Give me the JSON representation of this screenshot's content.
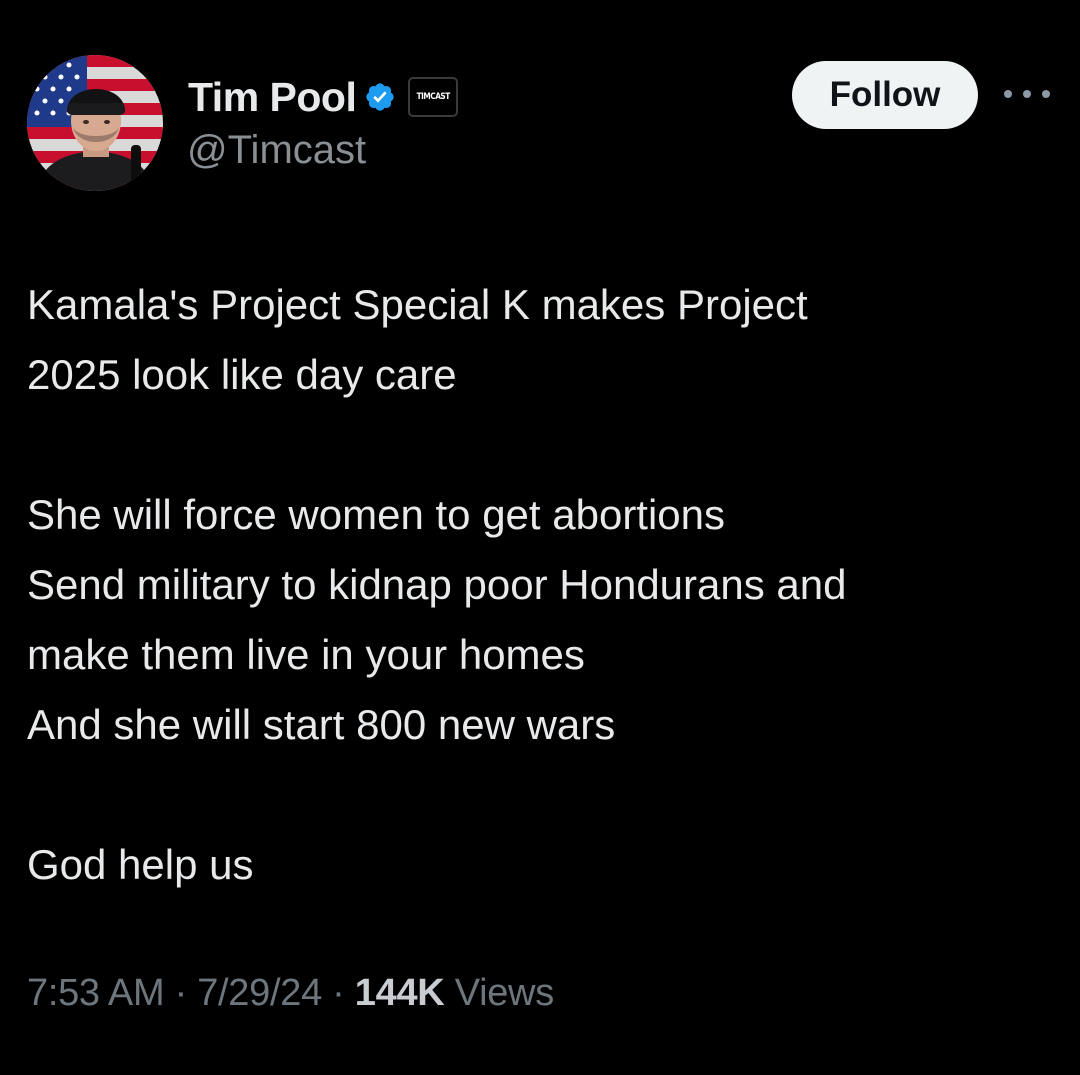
{
  "author": {
    "display_name": "Tim Pool",
    "handle": "@Timcast",
    "affiliate_badge_text": "TIMCAST",
    "verified_color": "#1d9bf0"
  },
  "actions": {
    "follow_label": "Follow",
    "more_icon": "more-horizontal-icon"
  },
  "tweet": {
    "lines": [
      "Kamala's Project Special K makes Project",
      "2025 look like day care",
      "",
      "She will force women to get abortions",
      "Send military to kidnap poor Hondurans and",
      "make them live in your homes",
      "And she will start 800 new wars",
      "",
      "God help us"
    ]
  },
  "meta": {
    "time": "7:53 AM",
    "separator": "·",
    "date": "7/29/24",
    "views_count": "144K",
    "views_label": "Views"
  },
  "colors": {
    "background": "#000000",
    "text": "#e7e9ea",
    "secondary_text": "#6e767d",
    "follow_button_bg": "#eff3f4"
  }
}
